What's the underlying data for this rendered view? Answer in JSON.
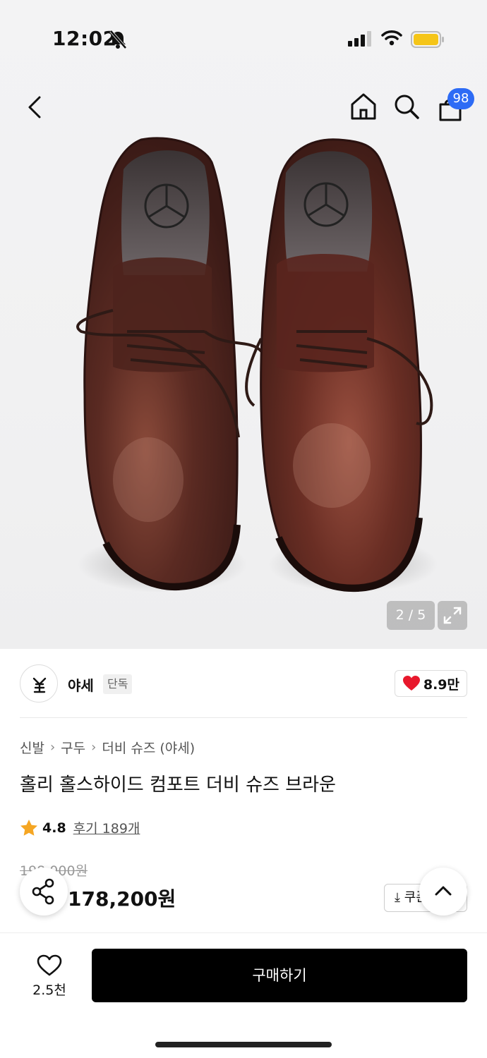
{
  "status_bar": {
    "time": "12:02",
    "icons": [
      "bell-off-icon",
      "signal-icon",
      "wifi-icon",
      "battery-icon"
    ],
    "battery_color": "#f5c518"
  },
  "nav": {
    "icons": [
      "back-icon",
      "home-icon",
      "search-icon",
      "shopping-bag-icon"
    ],
    "cart_count": "98",
    "badge_color": "#2d6bf5"
  },
  "gallery": {
    "counter": "2 / 5",
    "expand_icon": "expand-icon"
  },
  "brand": {
    "name": "야세",
    "tag": "단독",
    "likes": "8.9만",
    "like_color": "#e8182c"
  },
  "product": {
    "breadcrumb": [
      "신발",
      "구두",
      "더비 슈즈 (야세)"
    ],
    "title": "홀리 홀스하이드 컴포트 더비 슈즈 브라운",
    "rating": "4.8",
    "reviews": "후기 189개",
    "star_color": "#f5a623",
    "original_price": "198,000원",
    "sale_price": "178,200원",
    "coupon_label": "쿠폰"
  },
  "bottom_bar": {
    "wish_count": "2.5천",
    "buy_label": "구매하기"
  }
}
